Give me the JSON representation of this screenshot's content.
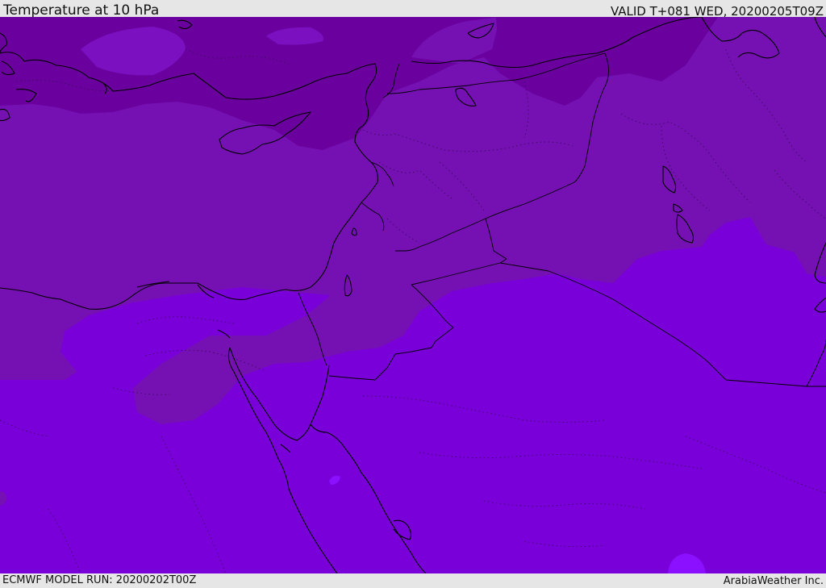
{
  "header": {
    "title": "Temperature at 10 hPa",
    "valid": "VALID T+081 WED, 20200205T09Z"
  },
  "footer": {
    "model_run": "ECMWF MODEL RUN: 20200202T00Z",
    "credit": "ArabiaWeather Inc."
  },
  "map": {
    "colors": {
      "band_darkest": "#6a009e",
      "band_dark": "#7511b2",
      "band_mid": "#7a00da",
      "band_light": "#8100f0",
      "coastline": "#000000",
      "border_dotted": "#3a0a5a"
    }
  }
}
